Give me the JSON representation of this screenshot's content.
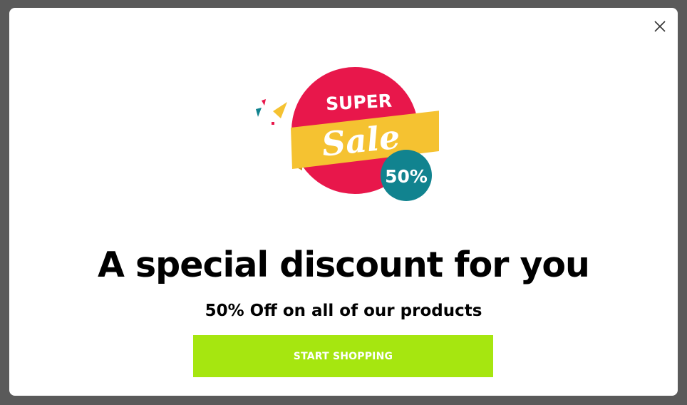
{
  "modal": {
    "close_icon": "close-icon",
    "graphic": {
      "super_text": "SUPER",
      "sale_text": "Sale",
      "badge_text": "50%"
    },
    "headline": "A special discount for you",
    "subheadline": "50% Off on all of our products",
    "cta_label": "START SHOPPING"
  },
  "colors": {
    "backdrop": "#5a5a5a",
    "modal_bg": "#ffffff",
    "cta_bg": "#a6e610",
    "cta_text": "#ffffff",
    "sale_circle": "#e8174b",
    "sale_ribbon": "#f5c231",
    "badge": "#11838f"
  }
}
